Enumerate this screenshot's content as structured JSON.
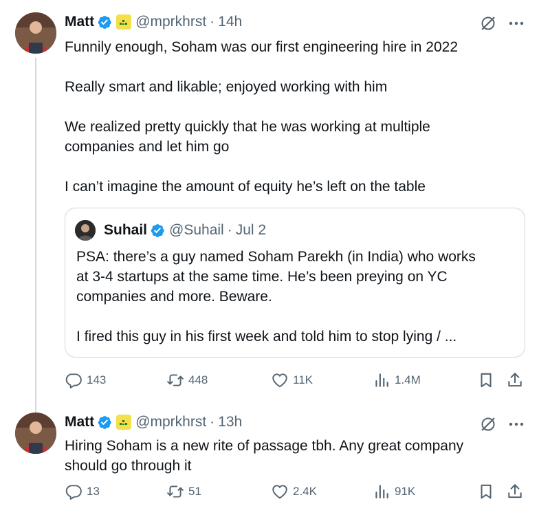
{
  "tweets": [
    {
      "author": {
        "name": "Matt",
        "handle": "@mprkhrst",
        "verified": true,
        "avatar_icon": "user-avatar-photo",
        "affiliate_icon": "yellow-badge-icon"
      },
      "time": "14h",
      "separator": "·",
      "paragraphs": [
        "Funnily enough, Soham was our first engineering hire in 2022",
        "Really smart and likable; enjoyed working with him",
        "We realized pretty quickly that he was working at multiple\ncompanies and let him go",
        "I can’t imagine the amount of equity he’s left on the table"
      ],
      "quote": {
        "author": {
          "name": "Suhail",
          "handle": "@Suhail",
          "verified": true
        },
        "time": "Jul 2",
        "separator": "·",
        "paragraphs": [
          "PSA: there’s a guy named Soham Parekh (in India) who works\nat 3-4 startups at the same time. He’s been preying on YC\ncompanies and more. Beware.",
          "I fired this guy in his first week and told him to stop lying / ..."
        ]
      },
      "stats": {
        "replies": "143",
        "retweets": "448",
        "likes": "11K",
        "views": "1.4M"
      }
    },
    {
      "author": {
        "name": "Matt",
        "handle": "@mprkhrst",
        "verified": true,
        "avatar_icon": "user-avatar-photo",
        "affiliate_icon": "yellow-badge-icon"
      },
      "time": "13h",
      "separator": "·",
      "paragraphs": [
        "Hiring Soham is a new rite of passage tbh. Any great company\nshould go through it"
      ],
      "stats": {
        "replies": "13",
        "retweets": "51",
        "likes": "2.4K",
        "views": "91K"
      }
    }
  ],
  "colors": {
    "verified_blue": "#1d9bf0",
    "secondary_text": "#536471",
    "border": "#cfd9de",
    "primary_text": "#0f1419"
  }
}
